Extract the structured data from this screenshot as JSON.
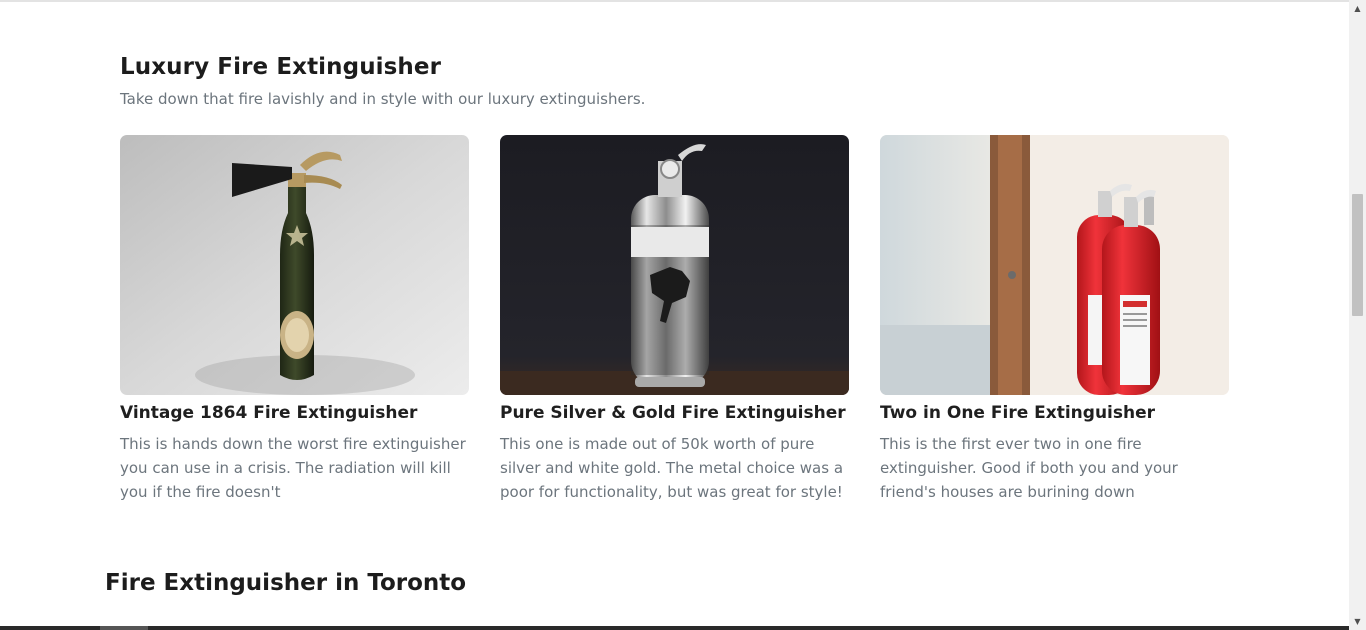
{
  "section": {
    "title": "Luxury Fire Extinguisher",
    "subtitle": "Take down that fire lavishly and in style with our luxury extinguishers."
  },
  "cards": [
    {
      "title": "Vintage 1864 Fire Extinguisher",
      "text": "This is hands down the worst fire extinguisher you can use in a crisis. The radiation will kill you if the fire doesn't",
      "image": "vintage-champagne-bottle-extinguisher"
    },
    {
      "title": "Pure Silver & Gold Fire Extinguisher",
      "text": "This one is made out of 50k worth of pure silver and white gold. The metal choice was a poor for functionality, but was great for style!",
      "image": "chrome-polo-extinguisher"
    },
    {
      "title": "Two in One Fire Extinguisher",
      "text": "This is the first ever two in one fire extinguisher. Good if both you and your friend's houses are burining down",
      "image": "two-red-extinguishers-hallway"
    }
  ],
  "next_section": {
    "title": "Fire Extinguisher in Toronto"
  },
  "scrollbar": {
    "up_icon": "arrow-up-icon",
    "down_icon": "arrow-down-icon",
    "up_glyph": "▲",
    "down_glyph": "▼"
  },
  "colors": {
    "heading": "#1c1c1c",
    "muted_text": "#6c757d",
    "extinguisher_red": "#e0262b"
  }
}
